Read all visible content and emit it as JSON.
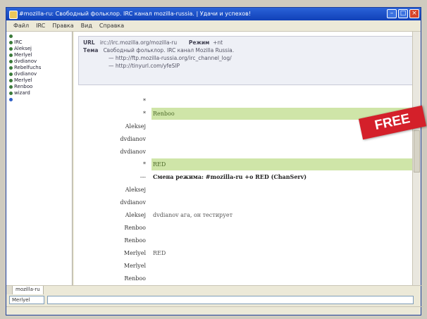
{
  "window": {
    "title": "#mozilla-ru: Свободный фольклор. IRC канал mozilla-russia. | Удачи и успехов!"
  },
  "menubar": [
    "Файл",
    "IRC",
    "Правка",
    "Вид",
    "Справка"
  ],
  "sidebar": {
    "users": [
      {
        "label": "",
        "status": "op"
      },
      {
        "label": "IRC",
        "status": "op"
      },
      {
        "label": "Aleksej",
        "status": "op"
      },
      {
        "label": "Merlyel",
        "status": "op"
      },
      {
        "label": "dvdianov",
        "status": "op"
      },
      {
        "label": "Rebelfuchs",
        "status": "op"
      },
      {
        "label": "dvdianov",
        "status": "op"
      },
      {
        "label": "Merlyel",
        "status": "op"
      },
      {
        "label": "Renboo",
        "status": "op"
      },
      {
        "label": "wizard",
        "status": "op"
      },
      {
        "label": "",
        "status": "voice"
      }
    ]
  },
  "topic": {
    "url_label": "URL",
    "url_value": "irc://irc.mozilla.org/mozilla-ru",
    "mode_label": "Режим",
    "mode_value": "+nt",
    "topic_label": "Тема",
    "topic_line1": "Свободный фольклор. IRC канал Mozilla Russia.",
    "topic_line2": "— http://ftp.mozilla-russia.org/irc_channel_log/",
    "topic_line3": "— http://tinyurl.com/yfeSlP"
  },
  "messages": [
    {
      "nick": "*",
      "text": "",
      "style": "yellow"
    },
    {
      "nick": "*",
      "text": "Renboo",
      "style": "green"
    },
    {
      "nick": "Aleksej",
      "text": "",
      "style": "dim"
    },
    {
      "nick": "dvdianov",
      "text": "",
      "style": "dim"
    },
    {
      "nick": "dvdianov",
      "text": "",
      "style": "dim"
    },
    {
      "nick": "*",
      "text": "RED",
      "style": "green"
    },
    {
      "nick": "---",
      "text": "Смена режима: #mozilla-ru +o RED (ChanServ)",
      "style": "bold"
    },
    {
      "nick": "Aleksej",
      "text": "",
      "style": "dim"
    },
    {
      "nick": "dvdianov",
      "text": "",
      "style": "dim"
    },
    {
      "nick": "Aleksej",
      "text": "dvdianov ага, он тестирует",
      "style": "normal"
    },
    {
      "nick": "Renboo",
      "text": "",
      "style": "dim"
    },
    {
      "nick": "Renboo",
      "text": "",
      "style": "dim"
    },
    {
      "nick": "Merlyel",
      "text": "RED",
      "style": "normal"
    },
    {
      "nick": "Merlyel",
      "text": "",
      "style": "dim"
    },
    {
      "nick": "Renboo",
      "text": "",
      "style": "dim"
    }
  ],
  "badge": {
    "label": "FREE",
    "color": "#d4202a"
  },
  "tabs": [
    "",
    "mozilla-ru"
  ],
  "input": {
    "nick": "Merlyel",
    "value": ""
  },
  "statusbar": {
    "text": ""
  }
}
